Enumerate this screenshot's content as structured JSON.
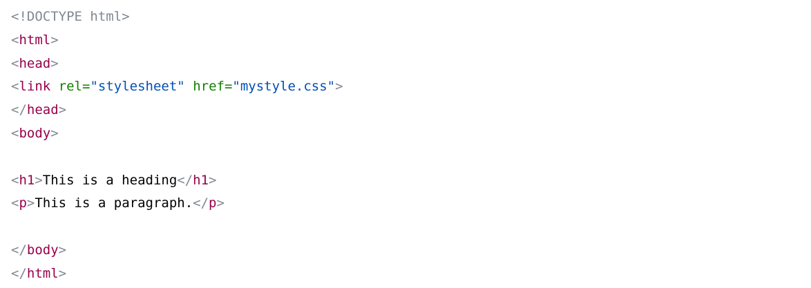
{
  "colors": {
    "bracket": "#808891",
    "tag": "#98004b",
    "attribute": "#128000",
    "value": "#0050b4",
    "text": "#000000",
    "background": "#ffffff"
  },
  "code": {
    "doctype": "<!DOCTYPE html>",
    "lt": "<",
    "gt": ">",
    "lt_slash": "</",
    "eq": "=",
    "space": " ",
    "tag_html": "html",
    "tag_head": "head",
    "tag_link": "link",
    "tag_body": "body",
    "tag_h1": "h1",
    "tag_p": "p",
    "attr_rel": "rel",
    "val_rel": "\"stylesheet\"",
    "attr_href": "href",
    "val_href": "\"mystyle.css\"",
    "h1_text": "This is a heading",
    "p_text": "This is a paragraph."
  }
}
